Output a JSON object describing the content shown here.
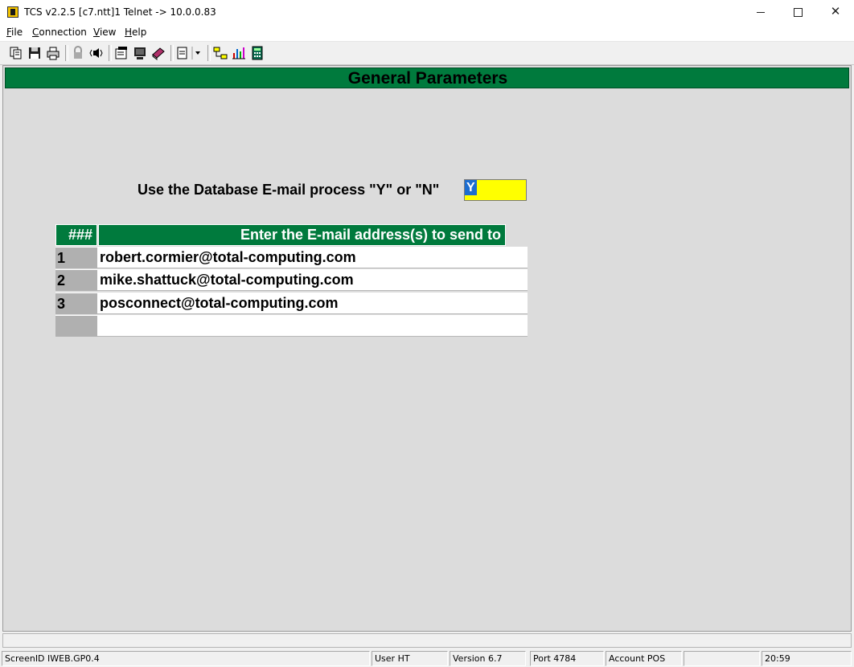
{
  "window": {
    "title": "TCS v2.2.5 [c7.ntt]1 Telnet -> 10.0.0.83",
    "min_label": "",
    "max_label": "",
    "close_label": "✕"
  },
  "menu": [
    "File",
    "Connection",
    "View",
    "Help"
  ],
  "toolbar": {
    "icons": [
      "copy-icon",
      "save-icon",
      "print-icon",
      "lock-icon",
      "speaker-icon",
      "properties-icon",
      "terminal-icon",
      "book-icon",
      "clipboard-dropdown-icon",
      "network-icon",
      "chart-icon",
      "calculator-icon"
    ]
  },
  "screen": {
    "header": "General Parameters",
    "prompt": "Use the Database E-mail process \"Y\" or \"N\"",
    "yn_value": "Y",
    "table": {
      "col_num": "###",
      "col_addr": "Enter the E-mail address(s) to send to",
      "rows": [
        {
          "num": "1",
          "addr": "robert.cormier@total-computing.com"
        },
        {
          "num": "2",
          "addr": "mike.shattuck@total-computing.com"
        },
        {
          "num": "3",
          "addr": "posconnect@total-computing.com"
        },
        {
          "num": "",
          "addr": ""
        }
      ]
    }
  },
  "status": {
    "screen_id": "ScreenID IWEB.GP0.4",
    "user": "User HT",
    "version": "Version 6.7",
    "port": "Port 4784",
    "account": "Account POS",
    "blank": "",
    "time": "20:59"
  },
  "colors": {
    "header_green": "#007a3d",
    "field_yellow": "#ffff00",
    "selection_blue": "#1c6dd0",
    "screen_gray": "#dcdcdc"
  }
}
